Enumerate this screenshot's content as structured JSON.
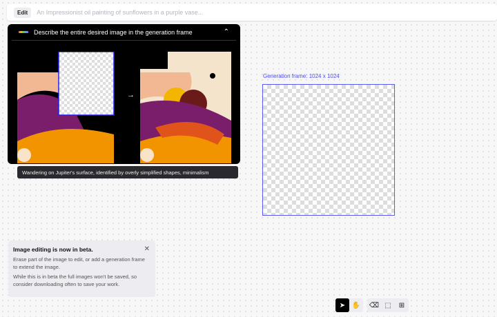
{
  "topbar": {
    "edit_label": "Edit",
    "prompt_placeholder": "An Impressionist oil painting of sunflowers in a purple vase..."
  },
  "tip_panel": {
    "title": "Describe the entire desired image in the generation frame",
    "caption": "Wandering on Jupiter's surface, identified by overly simplified shapes, minimalism"
  },
  "frame": {
    "label": "Generation frame: 1024 x 1024"
  },
  "notice": {
    "title": "Image editing is now in beta.",
    "line1": "Erase part of the image to edit, or add a generation frame to extend the image.",
    "line2": "While this is in beta the full images won't be saved, so consider downloading often to save your work."
  },
  "toolbar": {
    "tools": [
      "select-icon",
      "hand-icon",
      "eraser-icon",
      "frame-icon",
      "add-image-icon"
    ],
    "active": "select-icon"
  }
}
